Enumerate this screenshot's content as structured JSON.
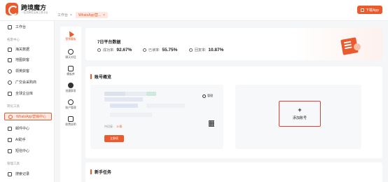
{
  "app": {
    "name": "跨境魔方",
    "subtitle": "一站式跨境出海工具平台",
    "brand_color": "#ea5a2d"
  },
  "tabs": [
    {
      "label": "工作台",
      "active": false
    },
    {
      "label": "WhatsApp营...",
      "active": true
    }
  ],
  "download_label": "下载App",
  "sidebar": {
    "top_item": {
      "label": "工作台",
      "icon": "workbench-icon"
    },
    "groups": [
      {
        "title": "拓客中心",
        "items": [
          {
            "label": "海关数据",
            "icon": "customs-data-icon"
          },
          {
            "label": "地图获客",
            "icon": "map-icon"
          },
          {
            "label": "领英获客",
            "icon": "linkedin-user-icon"
          },
          {
            "label": "广交会采购商",
            "icon": "globe-icon"
          },
          {
            "label": "全球企业库",
            "icon": "company-library-icon"
          }
        ]
      },
      {
        "title": "转化工具",
        "items": [
          {
            "label": "WhatsApp营销中心",
            "icon": "whatsapp-icon",
            "active": true
          },
          {
            "label": "邮件中心",
            "icon": "mail-icon"
          },
          {
            "label": "AI助手",
            "icon": "ai-assistant-icon"
          },
          {
            "label": "短信中心",
            "icon": "sms-icon"
          }
        ]
      },
      {
        "title": "管理工具",
        "items": [
          {
            "label": "搜索记录",
            "icon": "search-record-icon"
          }
        ]
      }
    ]
  },
  "subnav": [
    {
      "label": "营销看板",
      "icon": "send-icon",
      "active": true
    },
    {
      "label": "聊天对话",
      "icon": "chat-icon"
    },
    {
      "label": "模板库",
      "icon": "template-icon"
    },
    {
      "label": "创建群发",
      "icon": "broadcast-icon"
    },
    {
      "label": "账户管理",
      "icon": "account-icon"
    },
    {
      "label": "收费说明",
      "icon": "pricing-icon"
    }
  ],
  "stats": {
    "title": "7日平台数据",
    "items": [
      {
        "label": "成功率:",
        "value": "92.67%",
        "icon": "success-rate-icon"
      },
      {
        "label": "已读率:",
        "value": "55.75%",
        "icon": "read-rate-icon"
      },
      {
        "label": "回复率:",
        "value": "10.87%",
        "icon": "reply-rate-icon"
      }
    ]
  },
  "overview": {
    "title": "账号概览",
    "account": {
      "manage_label": "管理",
      "expire_label": "待回复:",
      "expire_value": "10条",
      "renew_label": "立即续"
    },
    "add_account": {
      "plus": "+",
      "label": "添加账号"
    }
  },
  "tasks": {
    "title": "新手任务"
  }
}
